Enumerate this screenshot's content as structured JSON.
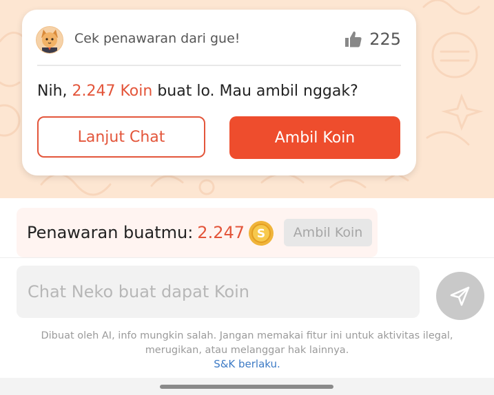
{
  "offer_card": {
    "header_title": "Cek penawaran dari gue!",
    "likes_count": "225",
    "message_prefix": "Nih, ",
    "message_amount": "2.247 Koin",
    "message_suffix": " buat lo. Mau ambil nggak?",
    "continue_label": "Lanjut Chat",
    "take_label": "Ambil Koin"
  },
  "offer_strip": {
    "label": "Penawaran buatmu:",
    "amount": "2.247",
    "button_label": "Ambil Koin"
  },
  "chat": {
    "input_value": "",
    "placeholder": "Chat Neko buat dapat Koin"
  },
  "footer": {
    "disclaimer_line1": "Dibuat oleh AI, info mungkin salah. Jangan memakai fitur ini untuk aktivitas ilegal,",
    "disclaimer_line2": "merugikan, atau melanggar hak lainnya.",
    "terms_link": "S&K berlaku."
  },
  "icons": {
    "avatar": "cat-avatar",
    "likes": "thumbs-up-icon",
    "coin": "coin-icon",
    "send": "send-icon"
  },
  "colors": {
    "accent": "#ee4d2d",
    "accent_text": "#e3553a",
    "background_pattern": "#fde6d2",
    "link": "#3c7ac5"
  }
}
